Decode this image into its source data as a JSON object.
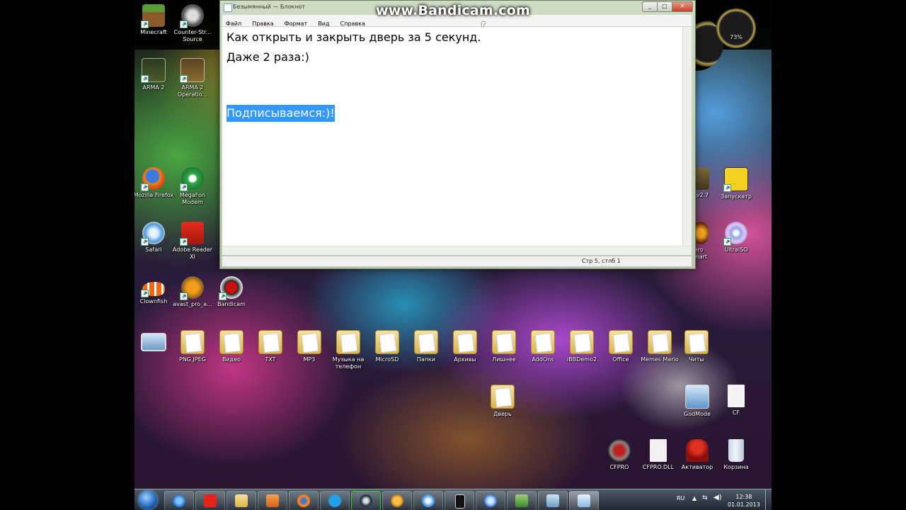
{
  "watermark": "www.Bandicam.com",
  "notepad": {
    "title": "Безымянный — Блокнот",
    "menu": [
      "Файл",
      "Правка",
      "Формат",
      "Вид",
      "Справка"
    ],
    "lines": [
      "Как открыть и закрыть дверь за 5 секунд.",
      "Даже 2 раза:)",
      "Подписываемся:)!"
    ],
    "status": "Стр 5, стлб 1",
    "selected_line_color": "#3399ff"
  },
  "desktop_icons": [
    {
      "label": "Minecraft",
      "icon": "minecraft-icon"
    },
    {
      "label": "Counter-Str... Source",
      "icon": "counter-strike-icon"
    },
    {
      "label": "ARMA 2",
      "icon": "arma2-icon"
    },
    {
      "label": "ARMA 2 Operatio...",
      "icon": "arma2-oa-icon"
    },
    {
      "label": "Mozilla Firefox",
      "icon": "firefox-icon"
    },
    {
      "label": "MegaFon Modem",
      "icon": "megafon-icon"
    },
    {
      "label": "Safari",
      "icon": "safari-icon"
    },
    {
      "label": "Adobe Reader XI",
      "icon": "adobe-reader-icon"
    },
    {
      "label": "Clownfish",
      "icon": "clownfish-icon"
    },
    {
      "label": "avast_pro_a...",
      "icon": "avast-icon"
    },
    {
      "label": "Bandicam",
      "icon": "bandicam-icon"
    },
    {
      "label": "PNG,JPEG",
      "icon": "folder-icon"
    },
    {
      "label": "Видео",
      "icon": "folder-icon"
    },
    {
      "label": "TXT",
      "icon": "folder-icon"
    },
    {
      "label": "MP3",
      "icon": "folder-icon"
    },
    {
      "label": "Музыка на телефон",
      "icon": "folder-icon"
    },
    {
      "label": "MicroSD",
      "icon": "folder-icon"
    },
    {
      "label": "Папки",
      "icon": "folder-icon"
    },
    {
      "label": "Архивы",
      "icon": "folder-icon"
    },
    {
      "label": "Лишнее",
      "icon": "folder-icon"
    },
    {
      "label": "AddOns",
      "icon": "folder-icon"
    },
    {
      "label": "iBBDemo2",
      "icon": "folder-icon"
    },
    {
      "label": "Office",
      "icon": "folder-icon"
    },
    {
      "label": "Memes Mario",
      "icon": "folder-icon"
    },
    {
      "label": "Читы",
      "icon": "folder-icon"
    },
    {
      "label": "Дверь",
      "icon": "folder-icon"
    },
    {
      "label": "Запускатр",
      "icon": "launcher-icon"
    },
    {
      "label": "UltraISO",
      "icon": "ultraiso-icon"
    },
    {
      "label": "GodMode",
      "icon": "godmode-icon"
    },
    {
      "label": "CF",
      "icon": "file-icon"
    },
    {
      "label": "CFPRO",
      "icon": "cfpro-icon"
    },
    {
      "label": "CFPRO.DLL",
      "icon": "dll-file-icon"
    },
    {
      "label": "Активатор",
      "icon": "activator-icon"
    },
    {
      "label": "Корзина",
      "icon": "recycle-bin-icon"
    }
  ],
  "partial_labels": [
    "ix_v2.7",
    "ero",
    "Smart"
  ],
  "gadget": {
    "percent": "73%"
  },
  "taskbar": {
    "lang": "RU",
    "time": "12:38",
    "date": "01.01.2013"
  }
}
